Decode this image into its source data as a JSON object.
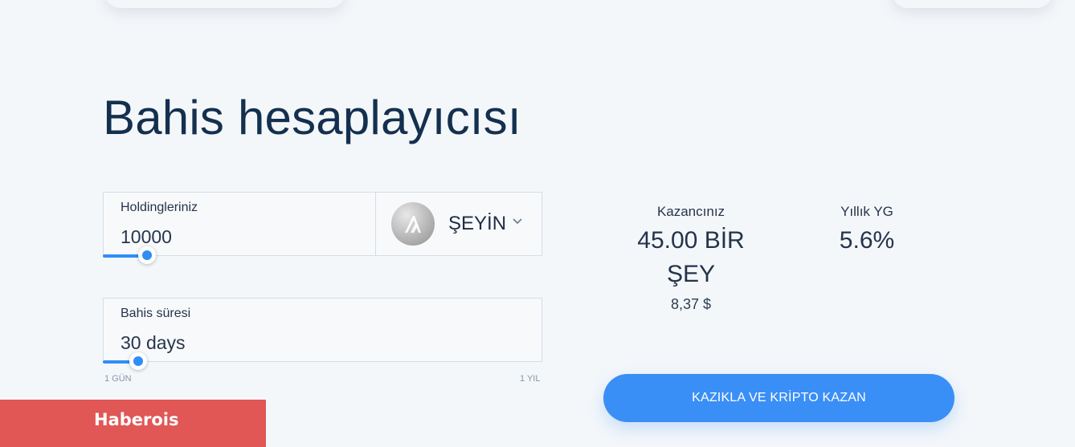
{
  "calculator": {
    "title": "Bahis hesaplayıcısı",
    "holdings": {
      "label": "Holdingleriniz",
      "value": "10000",
      "slider_fraction": 0.1
    },
    "coin": {
      "symbol": "ŞEYİN",
      "icon": "algorand-logo"
    },
    "duration": {
      "label": "Bahis süresi",
      "value": "30 days",
      "min_label": "1 GÜN",
      "max_label": "1 YIL",
      "slider_fraction": 0.082
    }
  },
  "results": {
    "earnings_label": "Kazancınız",
    "earnings_value": "45.00 BİR ŞEY",
    "earnings_usd": "8,37 $",
    "apy_label": "Yıllık YG",
    "apy_value": "5.6%"
  },
  "cta": {
    "label": "KAZIKLA VE KRİPTO KAZAN"
  },
  "brand": {
    "name": "Haberois"
  },
  "colors": {
    "accent": "#3a8ff6",
    "brand": "#e05756",
    "background": "#f4f7fa"
  }
}
